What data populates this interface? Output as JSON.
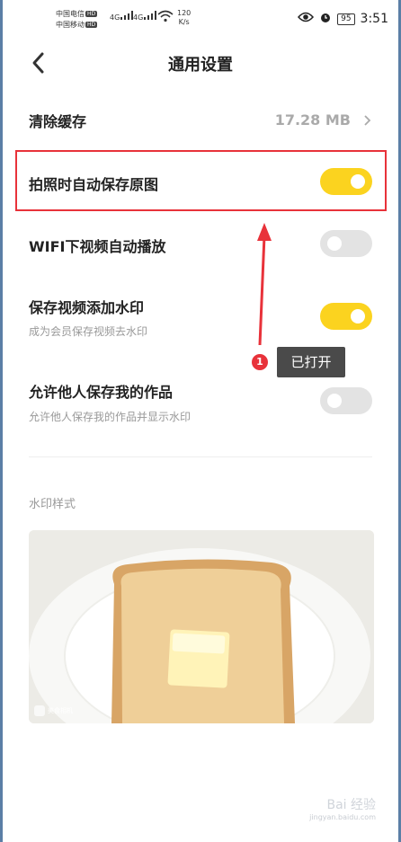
{
  "status_bar": {
    "carrier1": "中国电信",
    "carrier2": "中国移动",
    "hd": "HD",
    "net1": "4G",
    "net2": "4G",
    "speed_value": "120",
    "speed_unit": "K/s",
    "battery": "95",
    "time": "3:51"
  },
  "header": {
    "title": "通用设置"
  },
  "settings": {
    "clear_cache": {
      "label": "清除缓存",
      "value": "17.28 MB"
    },
    "save_original": {
      "label": "拍照时自动保存原图",
      "enabled": true
    },
    "wifi_autoplay": {
      "label": "WIFI下视频自动播放",
      "enabled": false
    },
    "video_watermark": {
      "label": "保存视频添加水印",
      "sub": "成为会员保存视频去水印",
      "enabled": true
    },
    "allow_others_save": {
      "label": "允许他人保存我的作品",
      "sub": "允许他人保存我的作品并显示水印",
      "enabled": false
    }
  },
  "watermark": {
    "label": "水印样式",
    "logo_text": "美食相机"
  },
  "annotation": {
    "badge": "1",
    "tip": "已打开"
  },
  "source_mark": {
    "text": "Bai 经验",
    "sub": "jingyan.baidu.com"
  },
  "colors": {
    "toggle_on": "#fbd31f",
    "toggle_off": "#e3e3e3",
    "annotation_red": "#e8323a"
  }
}
